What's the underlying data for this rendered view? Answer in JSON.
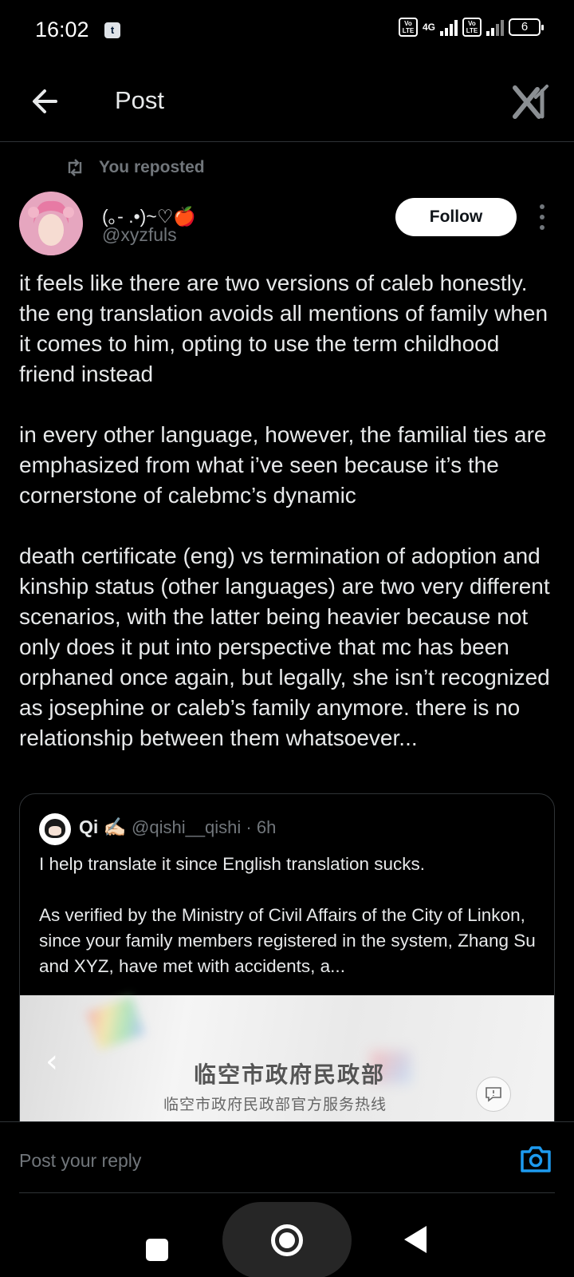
{
  "status_bar": {
    "time": "16:02",
    "notification_icon": "t",
    "network": "4G",
    "volte": "Vo LTE",
    "battery": "6"
  },
  "header": {
    "title": "Post",
    "back_icon": "arrow-left-icon",
    "logo_icon": "x-logo-icon"
  },
  "repost": {
    "label": "You reposted"
  },
  "author": {
    "display_name": "(｡- .•)~♡🍎",
    "handle": "@xyzfuls",
    "follow_label": "Follow"
  },
  "post": {
    "paragraphs": [
      "it feels like there are two versions of caleb honestly. the eng translation avoids all mentions of family when it comes to him, opting to use the term childhood friend instead",
      "in every other language, however, the familial ties are emphasized from what i’ve seen because it’s the cornerstone of calebmc’s dynamic",
      "death certificate (eng) vs termination of adoption and kinship status (other languages) are two very different scenarios, with the latter being heavier because not only does it put into perspective that mc has been orphaned once again, but legally, she isn’t recognized as josephine or caleb’s family anymore. there is no relationship between them whatsoever..."
    ]
  },
  "quote": {
    "name": "Qi ✍🏻",
    "handle_time": "@qishi__qishi · 6h",
    "paragraphs": [
      "I help translate it since English translation sucks.",
      "As verified by the Ministry of Civil Affairs of the City of Linkon, since your family members registered in the system, Zhang Su and XYZ, have met with accidents, a..."
    ],
    "media": {
      "title": "临空市政府民政部",
      "subtitle": "临空市政府民政部官方服务热线"
    }
  },
  "reply": {
    "placeholder": "Post your reply"
  },
  "colors": {
    "background": "#000000",
    "text": "#e7e9ea",
    "muted": "#71767b",
    "accent": "#1d9bf0",
    "divider": "#2f3336"
  }
}
